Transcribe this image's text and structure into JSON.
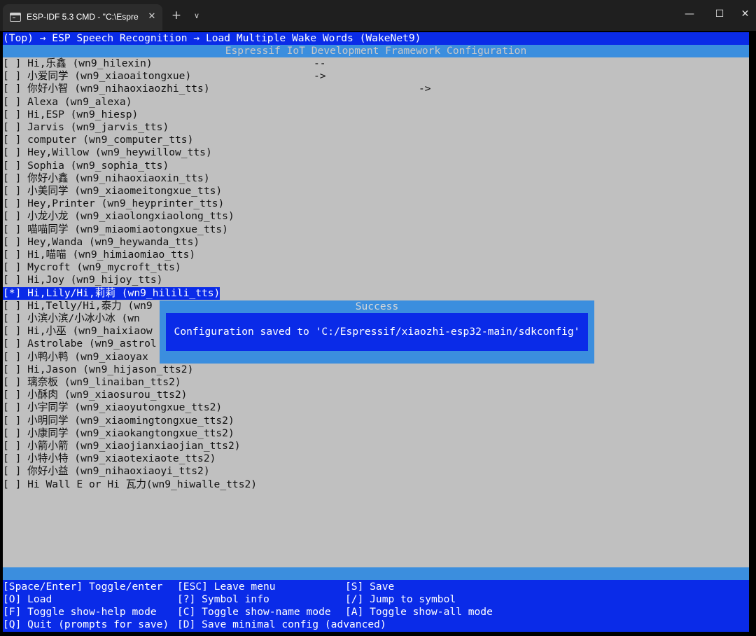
{
  "window": {
    "tab_title": "ESP-IDF 5.3 CMD - \"C:\\Espressif",
    "tab_close": "✕",
    "new_tab": "+",
    "tab_dropdown": "∨",
    "minimize": "—",
    "maximize": "☐",
    "close": "✕"
  },
  "terminal": {
    "breadcrumb": "(Top) → ESP Speech Recognition → Load Multiple Wake Words (WakeNet9)",
    "framework_title": "Espressif IoT Development Framework Configuration",
    "items": [
      {
        "text": "[ ] Hi,乐鑫 (wn9_hilexin)",
        "selected": false
      },
      {
        "text": "[ ] 小爱同学 (wn9_xiaoaitongxue)",
        "selected": false
      },
      {
        "text": "[ ] 你好小智 (wn9_nihaoxiaozhi_tts)",
        "selected": false
      },
      {
        "text": "[ ] Alexa (wn9_alexa)",
        "selected": false
      },
      {
        "text": "[ ] Hi,ESP (wn9_hiesp)",
        "selected": false
      },
      {
        "text": "[ ] Jarvis (wn9_jarvis_tts)",
        "selected": false
      },
      {
        "text": "[ ] computer (wn9_computer_tts)",
        "selected": false
      },
      {
        "text": "[ ] Hey,Willow (wn9_heywillow_tts)",
        "selected": false
      },
      {
        "text": "[ ] Sophia (wn9_sophia_tts)",
        "selected": false
      },
      {
        "text": "[ ] 你好小鑫 (wn9_nihaoxiaoxin_tts)",
        "selected": false
      },
      {
        "text": "[ ] 小美同学 (wn9_xiaomeitongxue_tts)",
        "selected": false
      },
      {
        "text": "[ ] Hey,Printer (wn9_heyprinter_tts)",
        "selected": false
      },
      {
        "text": "[ ] 小龙小龙 (wn9_xiaolongxiaolong_tts)",
        "selected": false
      },
      {
        "text": "[ ] 喵喵同学 (wn9_miaomiaotongxue_tts)",
        "selected": false
      },
      {
        "text": "[ ] Hey,Wanda (wn9_heywanda_tts)",
        "selected": false
      },
      {
        "text": "[ ] Hi,喵喵 (wn9_himiaomiao_tts)",
        "selected": false
      },
      {
        "text": "[ ] Mycroft (wn9_mycroft_tts)",
        "selected": false
      },
      {
        "text": "[ ] Hi,Joy (wn9_hijoy_tts)",
        "selected": false
      },
      {
        "text": "[*] Hi,Lily/Hi,莉莉 (wn9_hilili_tts)",
        "selected": true
      },
      {
        "text": "[ ] Hi,Telly/Hi,泰力 (wn9",
        "selected": false
      },
      {
        "text": "[ ] 小滨小滨/小冰小冰 (wn",
        "selected": false
      },
      {
        "text": "[ ] Hi,小巫 (wn9_haixiaow",
        "selected": false
      },
      {
        "text": "[ ] Astrolabe (wn9_astrol",
        "selected": false
      },
      {
        "text": "[ ] 小鸭小鸭 (wn9_xiaoyax",
        "selected": false
      },
      {
        "text": "[ ] Hi,Jason (wn9_hijason_tts2)",
        "selected": false
      },
      {
        "text": "[ ] 璃奈板 (wn9_linaiban_tts2)",
        "selected": false
      },
      {
        "text": "[ ] 小酥肉 (wn9_xiaosurou_tts2)",
        "selected": false
      },
      {
        "text": "[ ] 小宇同学 (wn9_xiaoyutongxue_tts2)",
        "selected": false
      },
      {
        "text": "[ ] 小明同学 (wn9_xiaomingtongxue_tts2)",
        "selected": false
      },
      {
        "text": "[ ] 小康同学 (wn9_xiaokangtongxue_tts2)",
        "selected": false
      },
      {
        "text": "[ ] 小箭小箭 (wn9_xiaojianxiaojian_tts2)",
        "selected": false
      },
      {
        "text": "[ ] 小特小特 (wn9_xiaotexiaote_tts2)",
        "selected": false
      },
      {
        "text": "[ ] 你好小益 (wn9_nihaoxiaoyi_tts2)",
        "selected": false
      },
      {
        "text": "[ ] Hi Wall E or Hi 瓦力(wn9_hiwalle_tts2)",
        "selected": false
      }
    ],
    "markers": {
      "line1": "--",
      "line2": "->",
      "line3": "->"
    },
    "help": {
      "row1": {
        "col1": "[Space/Enter] Toggle/enter",
        "col2": "[ESC] Leave menu",
        "col3": "[S] Save"
      },
      "row2": {
        "col1": "[O] Load",
        "col2": "[?] Symbol info",
        "col3": "[/] Jump to symbol"
      },
      "row3": {
        "col1": "[F] Toggle show-help mode",
        "col2": "[C] Toggle show-name mode",
        "col3": "[A] Toggle show-all mode"
      },
      "row4": {
        "col1": "[Q] Quit (prompts for save)",
        "col2": "[D] Save minimal config (advanced)",
        "col3": ""
      }
    },
    "dialog": {
      "title": "Success",
      "message": "Configuration saved to 'C:/Espressif/xiaozhi-esp32-main/sdkconfig'"
    }
  },
  "colors": {
    "menu_blue": "#0a2be8",
    "bar_lightblue": "#3b8ede",
    "list_gray": "#c0c0c0"
  }
}
